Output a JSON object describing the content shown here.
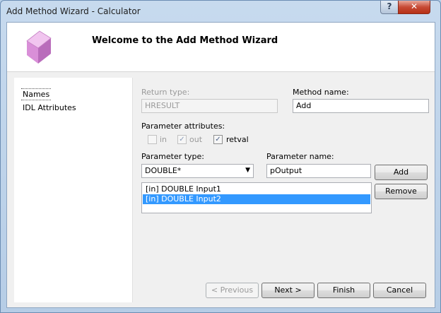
{
  "window": {
    "title": "Add Method Wizard - Calculator",
    "help_label": "?",
    "close_label": "✕"
  },
  "header": {
    "title": "Welcome to the Add Method Wizard",
    "icon": "cube-icon",
    "icon_color": "#d98fd8"
  },
  "nav": {
    "items": [
      {
        "label": "Names",
        "selected": true
      },
      {
        "label": "IDL Attributes",
        "selected": false
      }
    ]
  },
  "form": {
    "return_type": {
      "label": "Return type:",
      "value": "HRESULT",
      "enabled": false
    },
    "method_name": {
      "label": "Method name:",
      "value": "Add"
    },
    "param_attributes": {
      "label": "Parameter attributes:",
      "options": [
        {
          "label": "in",
          "checked": false,
          "enabled": false
        },
        {
          "label": "out",
          "checked": true,
          "enabled": false
        },
        {
          "label": "retval",
          "checked": true,
          "enabled": true
        }
      ]
    },
    "param_type": {
      "label": "Parameter type:",
      "value": "DOUBLE*"
    },
    "param_name": {
      "label": "Parameter name:",
      "value": "pOutput"
    },
    "params_list": [
      {
        "text": "[in] DOUBLE Input1",
        "selected": false
      },
      {
        "text": "[in] DOUBLE Input2",
        "selected": true
      }
    ],
    "add_label": "Add",
    "remove_label": "Remove"
  },
  "footer": {
    "previous_label": "< Previous",
    "next_label": "Next >",
    "finish_label": "Finish",
    "cancel_label": "Cancel"
  },
  "colors": {
    "selection": "#3399ff",
    "title_bar": "#b9d1ea",
    "close_button": "#c74a35"
  }
}
